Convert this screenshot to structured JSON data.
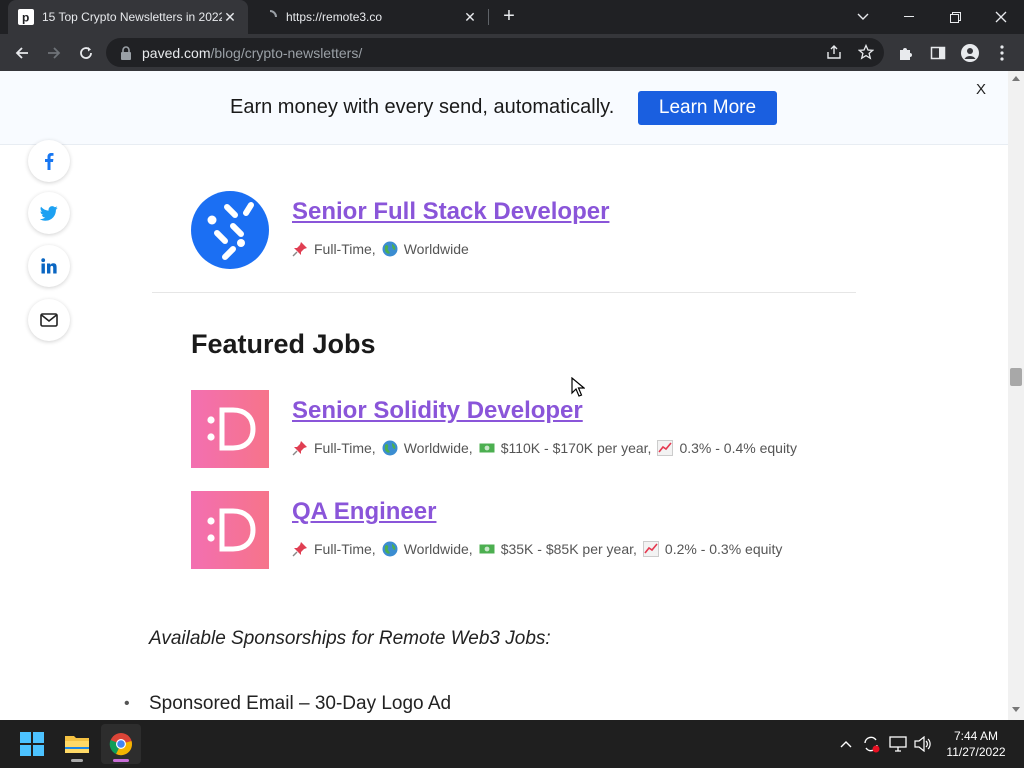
{
  "browser": {
    "tabs": [
      {
        "title": "15 Top Crypto Newsletters in 2022",
        "active": true
      },
      {
        "title": "https://remote3.co",
        "active": false
      }
    ],
    "url_host": "paved.com",
    "url_path": "/blog/crypto-newsletters/"
  },
  "banner": {
    "text": "Earn money with every send, automatically.",
    "button_label": "Learn More",
    "close_label": "X",
    "button_color": "#1a5fe0"
  },
  "share_icons": [
    "facebook-icon",
    "twitter-icon",
    "linkedin-icon",
    "email-icon"
  ],
  "top_job": {
    "title": "Senior Full Stack Developer",
    "type": "Full-Time,",
    "location": "Worldwide"
  },
  "featured": {
    "heading": "Featured Jobs",
    "jobs": [
      {
        "title": "Senior Solidity Developer",
        "type": "Full-Time,",
        "location": "Worldwide,",
        "salary": "$110K - $170K per year,",
        "equity": "0.3% - 0.4% equity"
      },
      {
        "title": "QA Engineer",
        "type": "Full-Time,",
        "location": "Worldwide,",
        "salary": "$35K - $85K per year,",
        "equity": "0.2% - 0.3% equity"
      }
    ]
  },
  "sponsorships": {
    "heading": "Available Sponsorships for Remote Web3 Jobs:",
    "items": [
      "Sponsored Email – 30-Day Logo Ad"
    ]
  },
  "taskbar": {
    "time": "7:44 AM",
    "date": "11/27/2022"
  },
  "colors": {
    "link": "#8a55d9",
    "chrome_dark": "#202124",
    "toolbar": "#35363a"
  }
}
